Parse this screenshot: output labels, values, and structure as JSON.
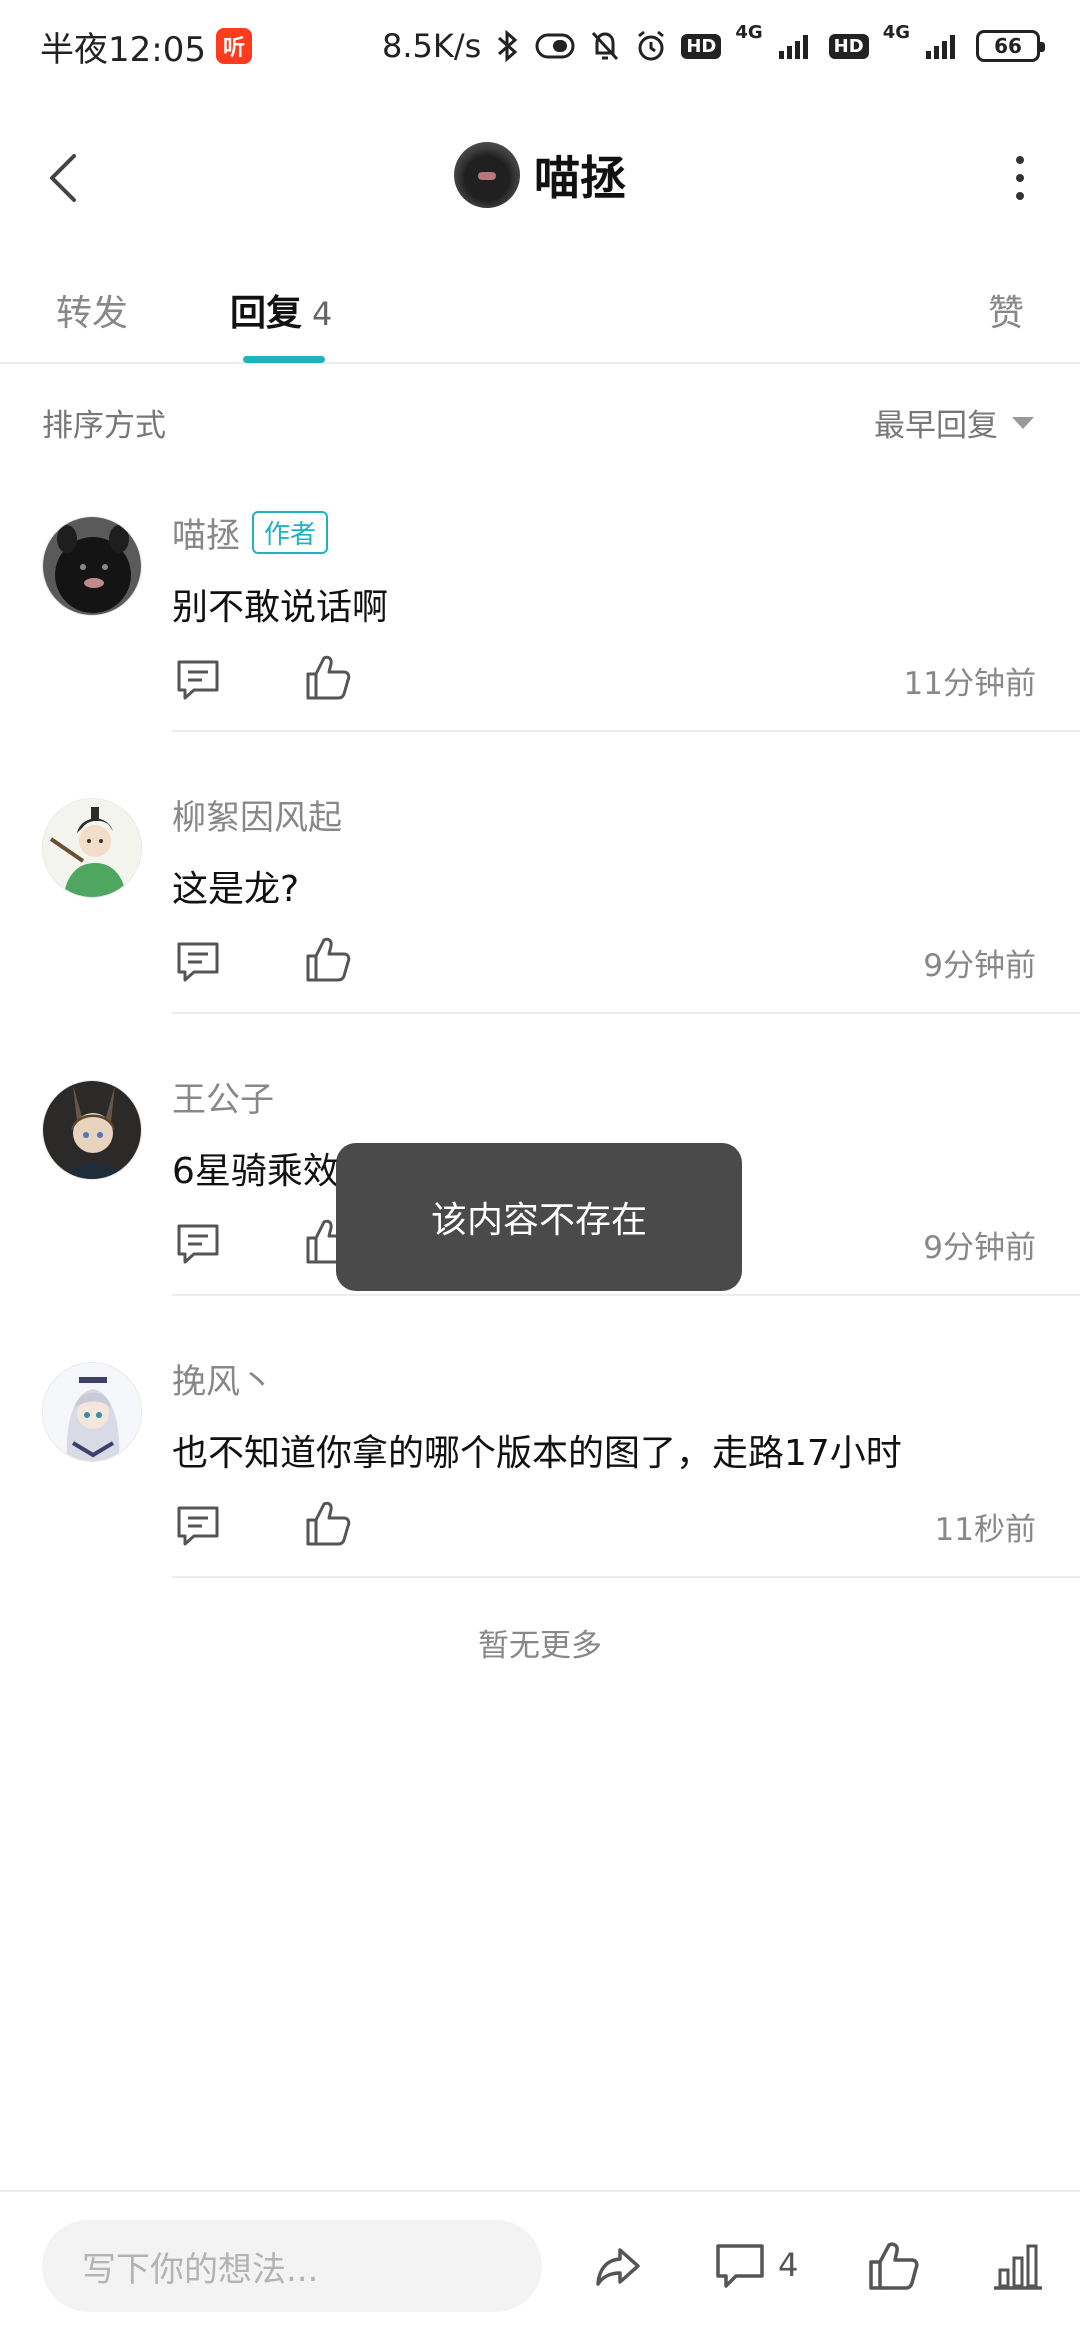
{
  "status_bar": {
    "time": "半夜12:05",
    "notification_badge": "听",
    "speed": "8.5K/s",
    "hd1": "HD",
    "net1": "4G",
    "hd2": "HD",
    "net2": "4G",
    "battery": "66"
  },
  "header": {
    "title": "喵拯"
  },
  "tabs": {
    "forward": "转发",
    "reply": "回复",
    "reply_count": "4",
    "like": "赞",
    "active": "reply"
  },
  "sort": {
    "label": "排序方式",
    "value": "最早回复"
  },
  "comments": [
    {
      "author": "喵拯",
      "tag": "作者",
      "text": "别不敢说话啊",
      "time": "11分钟前"
    },
    {
      "author": "柳絮因风起",
      "tag": "",
      "text": "这是龙?",
      "time": "9分钟前"
    },
    {
      "author": "王公子",
      "tag": "",
      "text": "6星骑乘效果",
      "time": "9分钟前"
    },
    {
      "author": "挽风丶",
      "tag": "",
      "text": "也不知道你拿的哪个版本的图了，走路17小时",
      "time": "11秒前"
    }
  ],
  "no_more": "暂无更多",
  "toast": "该内容不存在",
  "bottom_bar": {
    "input_placeholder": "写下你的想法...",
    "comment_count": "4"
  },
  "colors": {
    "accent": "#1fb3bd",
    "toast_bg": "#4a4a4a",
    "badge": "#ff3b1f"
  }
}
